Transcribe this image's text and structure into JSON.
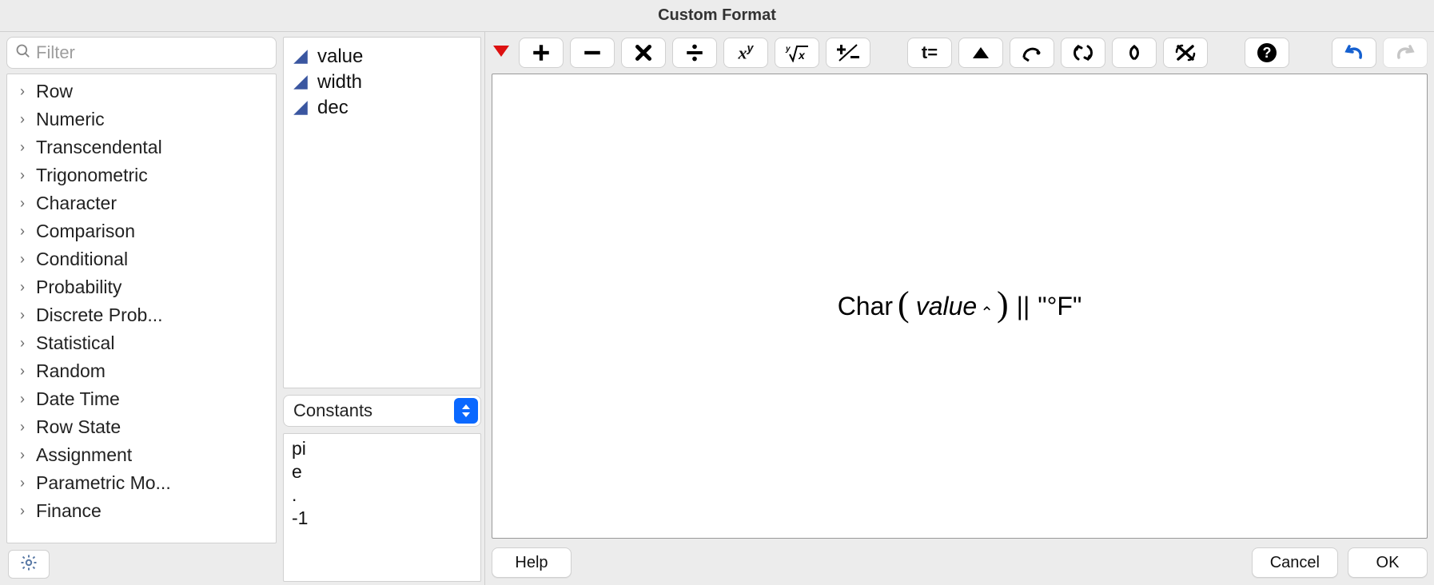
{
  "window": {
    "title": "Custom Format"
  },
  "search": {
    "placeholder": "Filter",
    "value": ""
  },
  "categories": [
    "Row",
    "Numeric",
    "Transcendental",
    "Trigonometric",
    "Character",
    "Comparison",
    "Conditional",
    "Probability",
    "Discrete Prob...",
    "Statistical",
    "Random",
    "Date Time",
    "Row State",
    "Assignment",
    "Parametric Mo...",
    "Finance"
  ],
  "variables": [
    "value",
    "width",
    "dec"
  ],
  "constants_dropdown": {
    "selected": "Constants"
  },
  "constants": [
    "pi",
    "e",
    ".",
    "-1"
  ],
  "formula": {
    "function": "Char",
    "arg": "value",
    "concat_op": "||",
    "literal": "\"°F\""
  },
  "toolbar": {
    "op_plus": "plus",
    "op_minus": "minus",
    "op_times": "times",
    "op_divide": "divide",
    "op_power": "power",
    "op_root": "root",
    "op_plusminus": "plusminus",
    "op_localassign": "local-assign",
    "op_insert": "insert",
    "op_peel": "peel",
    "op_switch": "switch",
    "op_unnest": "unnest",
    "op_delete": "delete",
    "op_help": "help",
    "op_undo": "undo",
    "op_redo": "redo"
  },
  "footer": {
    "help": "Help",
    "cancel": "Cancel",
    "ok": "OK"
  }
}
